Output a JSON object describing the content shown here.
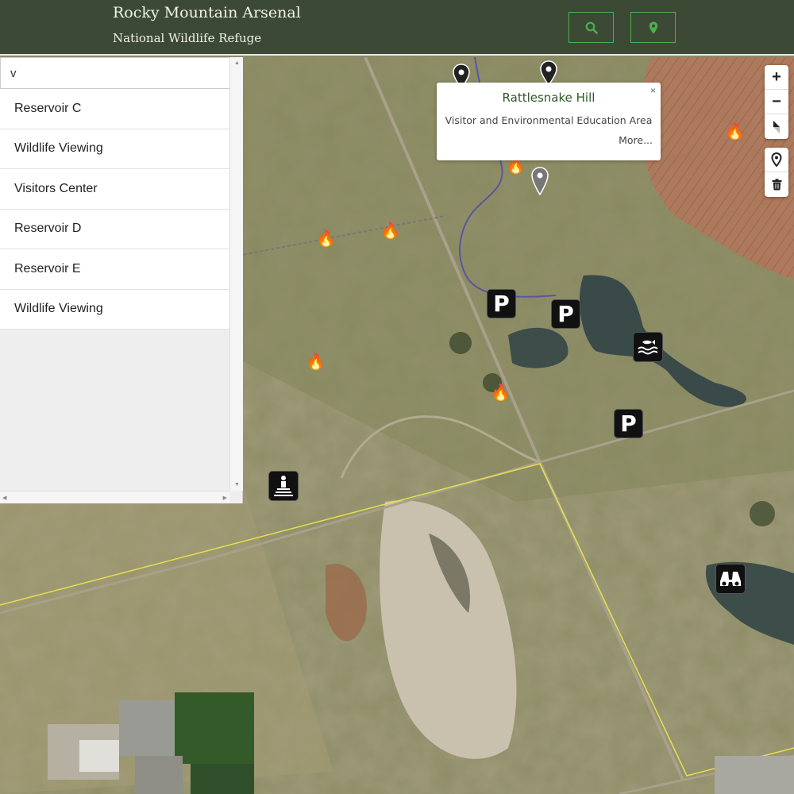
{
  "header": {
    "title": "Rocky Mountain Arsenal",
    "subtitle": "National Wildlife Refuge",
    "search_button_icon": "search-icon",
    "location_button_icon": "map-pin-icon",
    "accent_color": "#4caf50",
    "background_color": "#3c4a35"
  },
  "search": {
    "value": "v",
    "results": [
      {
        "label": "Reservoir C"
      },
      {
        "label": "Wildlife Viewing"
      },
      {
        "label": "Visitors Center"
      },
      {
        "label": "Reservoir D"
      },
      {
        "label": "Reservoir E"
      },
      {
        "label": "Wildlife Viewing"
      }
    ]
  },
  "popup": {
    "title": "Rattlesnake Hill",
    "subtitle": "Visitor and Environmental Education Area",
    "more_label": "More...",
    "close_label": "×"
  },
  "map_controls": {
    "zoom_in": "+",
    "zoom_out": "−",
    "compass_icon": "compass-icon",
    "marker_tool_icon": "map-pin-icon",
    "delete_tool_icon": "trash-icon"
  },
  "markers": {
    "parking_label": "P",
    "parking_icon": "parking-icon",
    "fishing_icon": "fishing-icon",
    "visitor_center_icon": "visitor-center-icon",
    "wildlife_viewing_icon": "binoculars-icon",
    "fire_icon": "fire-icon",
    "location_icon": "map-pin-icon"
  }
}
